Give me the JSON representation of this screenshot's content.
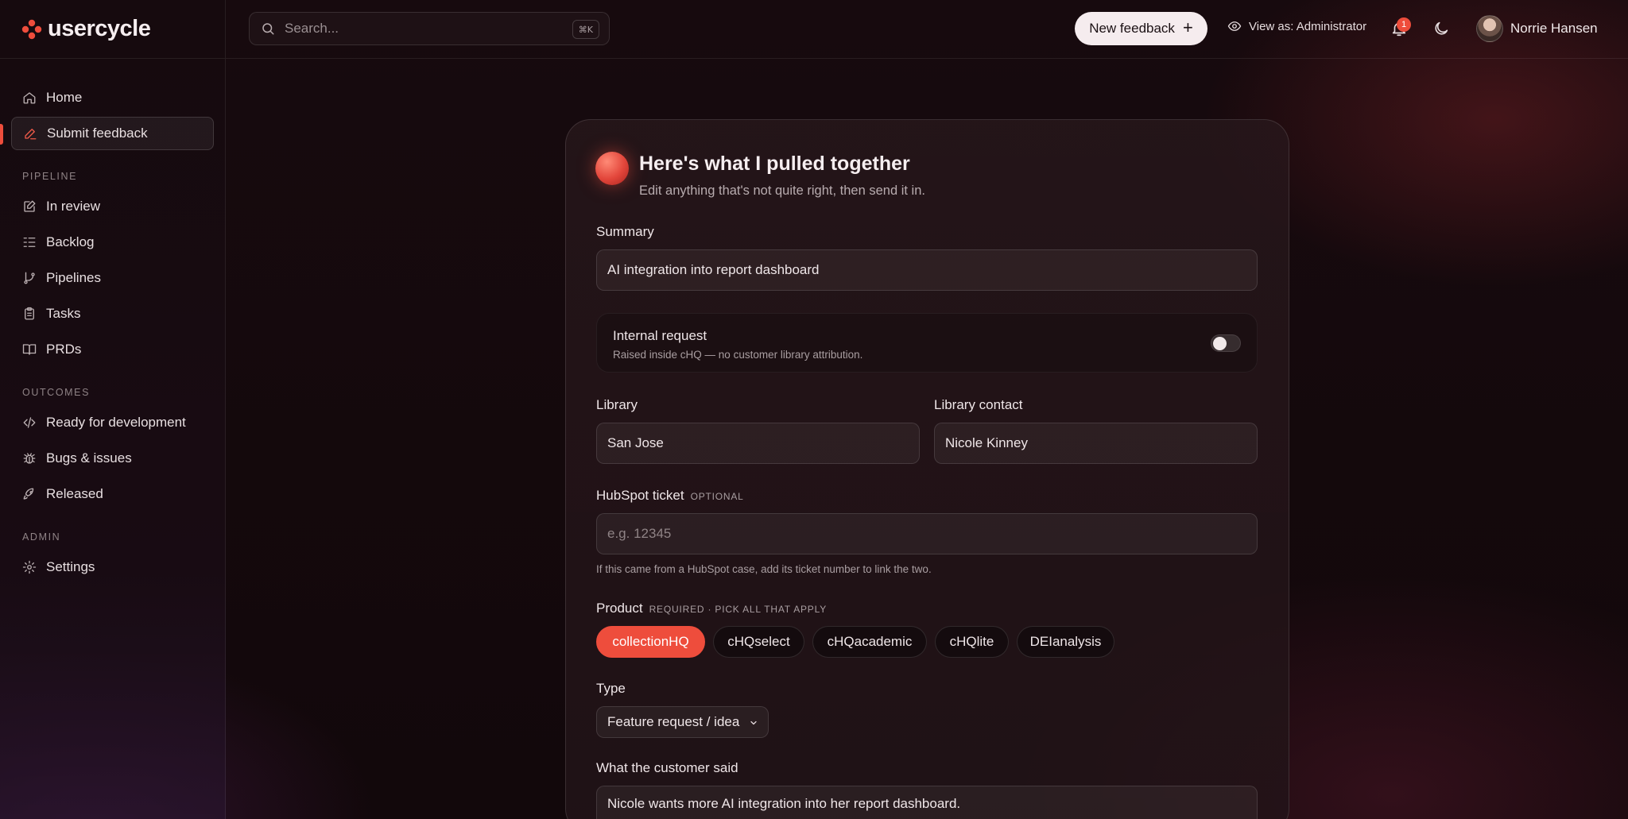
{
  "brand": {
    "name": "usercycle"
  },
  "sidebar": {
    "items_top": [
      {
        "label": "Home",
        "icon": "home-icon"
      },
      {
        "label": "Submit feedback",
        "icon": "pencil-icon",
        "active": true
      }
    ],
    "sections": [
      {
        "title": "PIPELINE",
        "items": [
          {
            "label": "In review",
            "icon": "edit-square-icon"
          },
          {
            "label": "Backlog",
            "icon": "checklist-icon"
          },
          {
            "label": "Pipelines",
            "icon": "git-branch-icon"
          },
          {
            "label": "Tasks",
            "icon": "clipboard-icon"
          },
          {
            "label": "PRDs",
            "icon": "book-open-icon"
          }
        ]
      },
      {
        "title": "OUTCOMES",
        "items": [
          {
            "label": "Ready for development",
            "icon": "code-icon"
          },
          {
            "label": "Bugs & issues",
            "icon": "bug-icon"
          },
          {
            "label": "Released",
            "icon": "rocket-icon"
          }
        ]
      },
      {
        "title": "ADMIN",
        "items": [
          {
            "label": "Settings",
            "icon": "gear-icon"
          }
        ]
      }
    ]
  },
  "topbar": {
    "search_placeholder": "Search...",
    "search_shortcut": "⌘K",
    "new_feedback_label": "New feedback",
    "view_as_label": "View as: Administrator",
    "notification_count": "1",
    "user_name": "Norrie Hansen"
  },
  "card": {
    "title": "Here's what I pulled together",
    "subtitle": "Edit anything that's not quite right, then send it in.",
    "summary_label": "Summary",
    "summary_value": "AI integration into report dashboard",
    "internal_title": "Internal request",
    "internal_sub": "Raised inside cHQ — no customer library attribution.",
    "internal_on": false,
    "library_label": "Library",
    "library_value": "San Jose",
    "contact_label": "Library contact",
    "contact_value": "Nicole Kinney",
    "hubspot_label": "HubSpot ticket",
    "hubspot_hint": "OPTIONAL",
    "hubspot_placeholder": "e.g. 12345",
    "hubspot_help": "If this came from a HubSpot case, add its ticket number to link the two.",
    "product_label": "Product",
    "product_hint": "REQUIRED · PICK ALL THAT APPLY",
    "products": [
      {
        "label": "collectionHQ",
        "selected": true
      },
      {
        "label": "cHQselect",
        "selected": false
      },
      {
        "label": "cHQacademic",
        "selected": false
      },
      {
        "label": "cHQlite",
        "selected": false
      },
      {
        "label": "DEIanalysis",
        "selected": false
      }
    ],
    "type_label": "Type",
    "type_value": "Feature request / idea",
    "said_label": "What the customer said",
    "said_value": "Nicole wants more AI integration into her report dashboard."
  },
  "colors": {
    "accent": "#ee4d3c",
    "background": "#150a0d"
  }
}
